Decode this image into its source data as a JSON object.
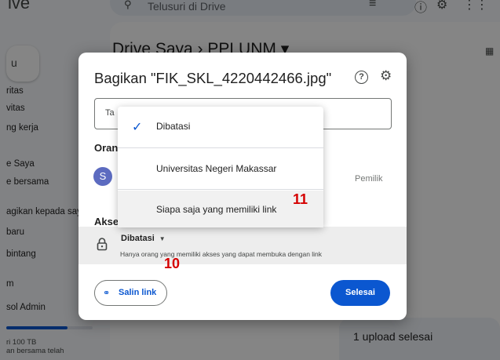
{
  "background": {
    "app_title_fragment": "ive",
    "search_placeholder": "Telusuri di Drive",
    "breadcrumb": "Drive Saya  ›  PPLUNM ▾",
    "sidebar_items": [
      "ritas",
      "vitas",
      "ng kerja",
      "e Saya",
      "e bersama",
      "agikan kepada say",
      "baru",
      "bintang",
      "m",
      "sol Admin"
    ],
    "storage_text": [
      "ri 100 TB",
      "an bersama telah"
    ],
    "upload_status": "1 upload selesai"
  },
  "dialog": {
    "title": "Bagikan \"FIK_SKL_4220442466.jpg\"",
    "help_icon": "help-icon",
    "settings_icon": "gear-icon",
    "add_people_placeholder": "Ta",
    "people_heading": "Orang",
    "owner_avatar_letter": "S",
    "owner_role": "Pemilik",
    "general_access_heading": "Akses",
    "access_selected": "Dibatasi",
    "access_description": "Hanya orang yang memiliki akses yang dapat membuka dengan link",
    "copy_link_label": "Salin link",
    "done_label": "Selesai"
  },
  "menu": {
    "items": [
      {
        "label": "Dibatasi",
        "checked": true
      },
      {
        "label": "Universitas Negeri Makassar",
        "checked": false
      },
      {
        "label": "Siapa saja yang memiliki link",
        "checked": false
      }
    ]
  },
  "annotations": {
    "step10": "10",
    "step11": "11"
  },
  "colors": {
    "accent": "#0b57d0",
    "annotation": "#d50000",
    "avatar": "#5c6bc0"
  }
}
